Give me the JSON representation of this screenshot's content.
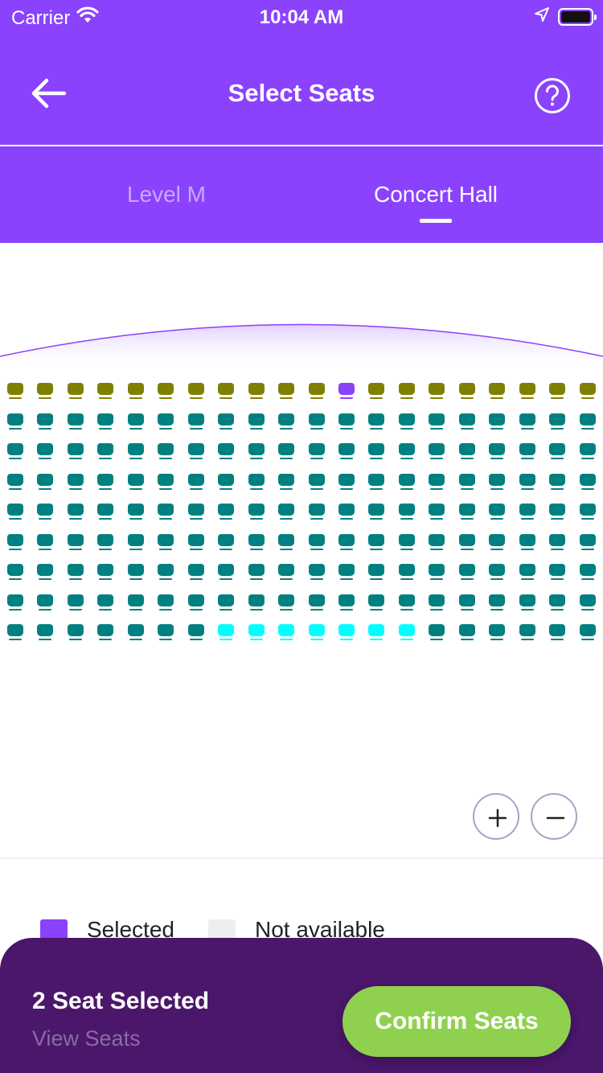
{
  "status_bar": {
    "carrier": "Carrier",
    "time": "10:04 AM",
    "icons": [
      "wifi-icon",
      "location-arrow-icon",
      "battery-icon"
    ]
  },
  "header": {
    "title": "Select Seats",
    "back_icon": "arrow-left-icon",
    "help_icon": "question-circle-icon"
  },
  "tabs": [
    {
      "label": "Level M",
      "active": false
    },
    {
      "label": "Concert Hall",
      "active": true
    }
  ],
  "seat_map": {
    "columns": 20,
    "seat_types": {
      "premium": "#808000",
      "standard": "#008080",
      "selected": "#8a42fd",
      "highlighted": "#00ffff",
      "not_available": "#eeeeee"
    },
    "rows": [
      "PPPPPPPPPPPSPPPPPPPP",
      "TTTTTTTTTTTTTTTTTTTT",
      "TTTTTTTTTTTTTTTTTTTT",
      "TTTTTTTTTTTTTTTTTTTT",
      "TTTTTTTTTTTTTTTTTTTT",
      "TTTTTTTTTTTTTTTTTTTT",
      "TTTTTTTTTTTTTTTTTTTT",
      "TTTTTTTTTTTTTTTTTTTT",
      "TTTTTTTCCCCCCCTTTTTT"
    ]
  },
  "zoom": {
    "zoom_in_icon": "plus-icon",
    "zoom_out_icon": "minus-icon"
  },
  "legend": {
    "selected_label": "Selected",
    "not_available_label": "Not available"
  },
  "footer": {
    "seat_count_text": "2 Seat Selected",
    "view_seats_label": "View Seats",
    "confirm_label": "Confirm Seats"
  },
  "colors": {
    "primary": "#8a42fd",
    "footer_bg": "#4a176b",
    "confirm_bg": "#8fd14f"
  }
}
